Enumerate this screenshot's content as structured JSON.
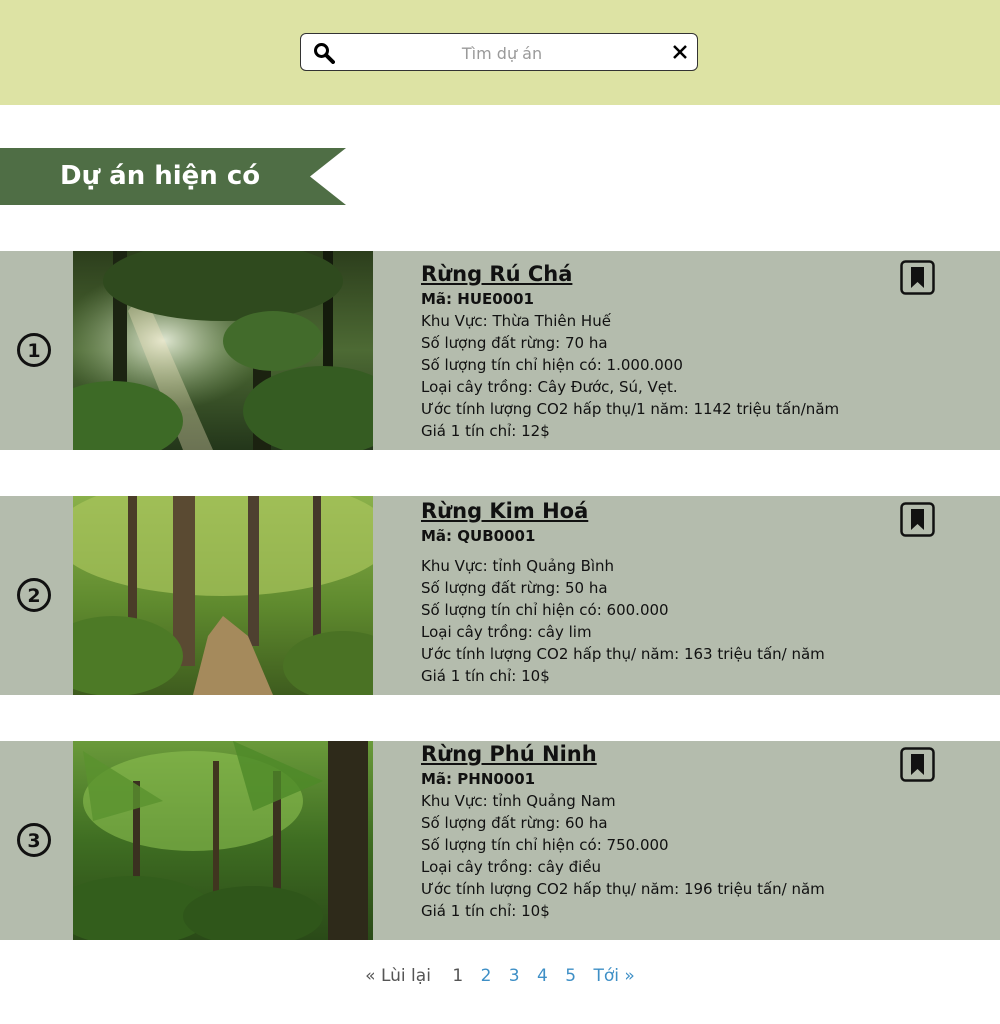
{
  "search": {
    "placeholder": "Tìm dự án"
  },
  "section": {
    "title": "Dự án hiện có"
  },
  "colors": {
    "topbar": "#dde3a4",
    "banner": "#4f6e45",
    "card": "#b4bcad",
    "link": "#3e8fc6"
  },
  "projects": [
    {
      "number": "1",
      "name": "Rừng Rú Chá",
      "code": "Mã: HUE0001",
      "details": [
        "Khu Vực: Thừa Thiên Huế",
        "Số lượng đất rừng: 70 ha",
        "Số lượng tín chỉ hiện có: 1.000.000",
        "Loại cây trồng: Cây Đước, Sú, Vẹt.",
        "Ước tính lượng CO2 hấp thụ/1 năm: 1142 triệu tấn/năm",
        "Giá 1 tín chỉ: 12$"
      ]
    },
    {
      "number": "2",
      "name": "Rừng Kim Hoá",
      "code": "Mã: QUB0001",
      "details": [
        "Khu Vực: tỉnh Quảng Bình",
        "Số lượng đất rừng: 50 ha",
        "Số lượng tín chỉ hiện có: 600.000",
        "Loại cây trồng: cây lim",
        "Ước tính lượng CO2 hấp thụ/ năm: 163 triệu tấn/ năm",
        "Giá 1 tín chỉ: 10$"
      ]
    },
    {
      "number": "3",
      "name": "Rừng Phú Ninh",
      "code": "Mã: PHN0001",
      "details": [
        "Khu Vực: tỉnh Quảng Nam",
        "Số lượng đất rừng: 60 ha",
        "Số lượng tín chỉ hiện có: 750.000",
        "Loại cây trồng: cây điều",
        "Ước tính lượng CO2 hấp thụ/ năm: 196 triệu tấn/ năm",
        "Giá 1 tín chỉ: 10$"
      ]
    }
  ],
  "pagination": {
    "prev": "« Lùi lại",
    "current": "1",
    "pages": [
      "2",
      "3",
      "4",
      "5"
    ],
    "next": "Tới »"
  }
}
